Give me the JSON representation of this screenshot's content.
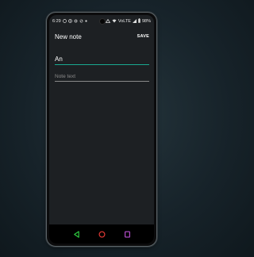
{
  "status_bar": {
    "time": "6:29",
    "left_icons": [
      "notification-icon",
      "notification-icon",
      "sync-icon",
      "settings-icon",
      "dot-icon"
    ],
    "right_icons": [
      "signal-icon",
      "wifi-icon",
      "lte-icon",
      "battery-icon"
    ],
    "network_label": "VoLTE",
    "battery": "98%"
  },
  "app_bar": {
    "title": "New note",
    "save_label": "SAVE"
  },
  "form": {
    "title_value": "An",
    "text_placeholder": "Note text",
    "accent_color": "#19a991"
  },
  "nav_bar": {
    "icons": [
      "back-icon",
      "home-icon",
      "recents-icon"
    ],
    "colors": {
      "back": "#2ecc40",
      "home": "#e53935",
      "recents": "#b94fd1"
    }
  }
}
